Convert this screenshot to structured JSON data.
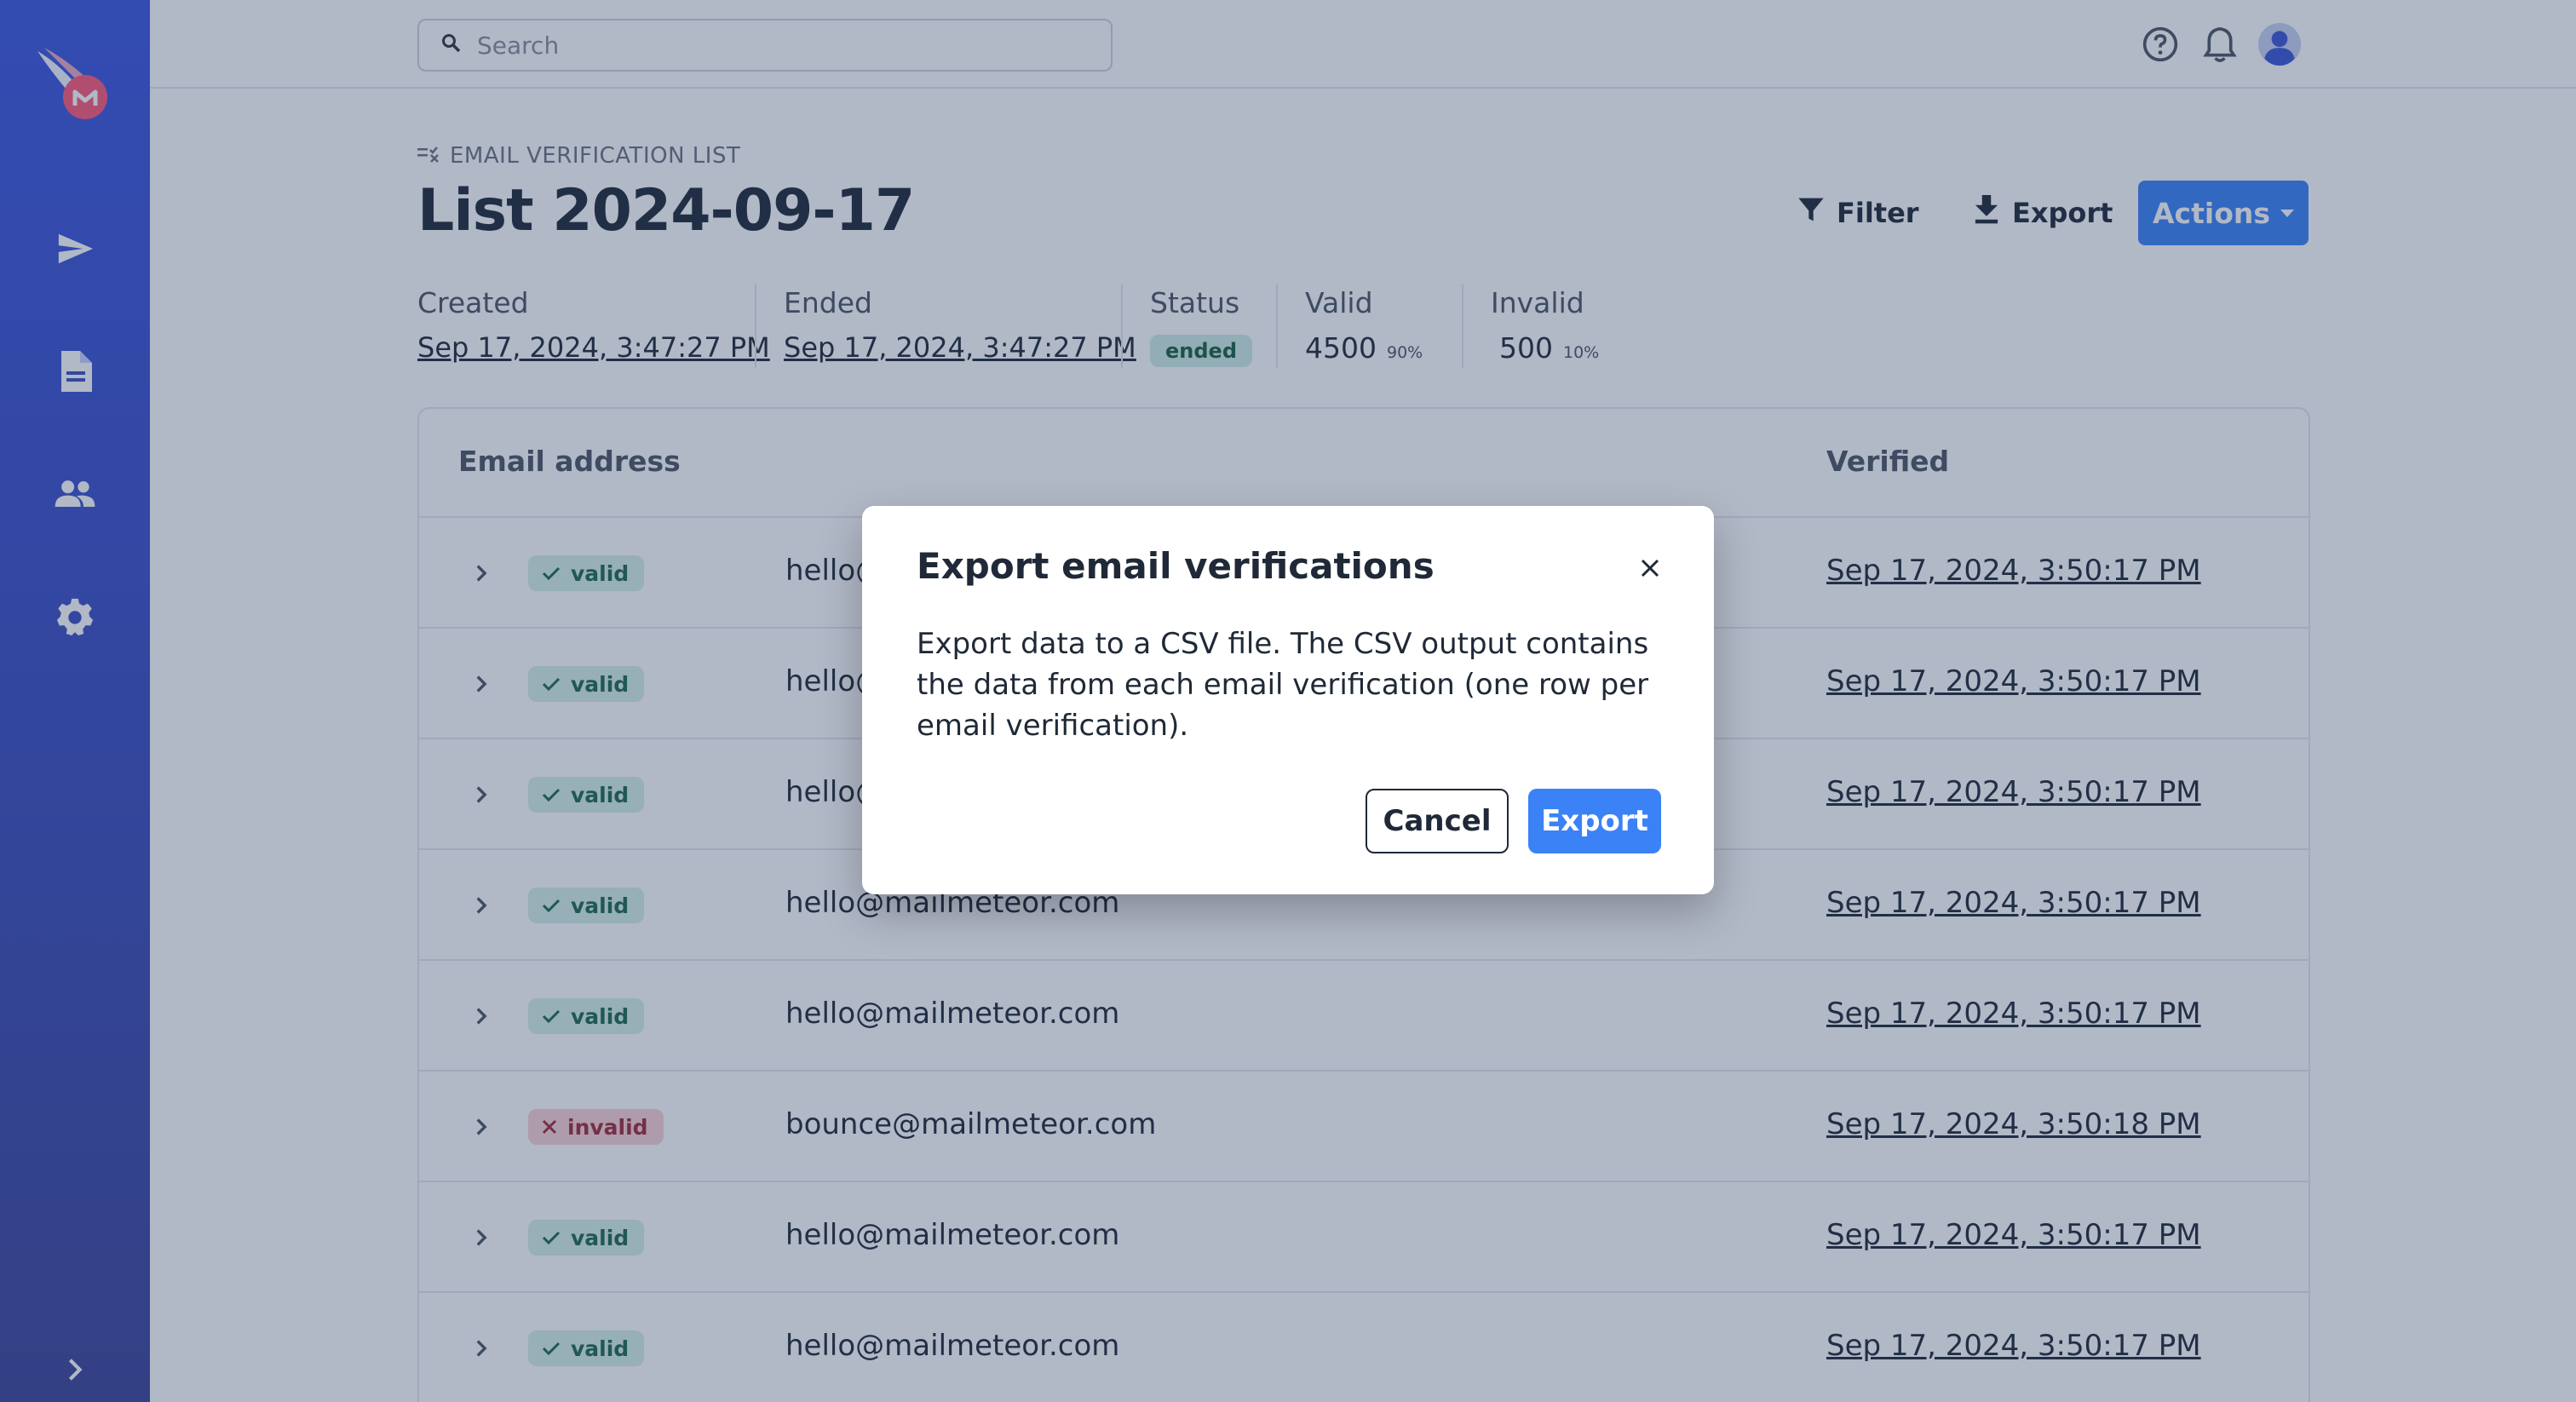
{
  "search": {
    "placeholder": "Search"
  },
  "breadcrumb": {
    "label": "EMAIL VERIFICATION LIST"
  },
  "page": {
    "title": "List 2024-09-17"
  },
  "toolbar": {
    "filter_label": "Filter",
    "export_label": "Export",
    "actions_label": "Actions"
  },
  "stats": {
    "created_label": "Created",
    "created_value": "Sep 17, 2024, 3:47:27 PM",
    "ended_label": "Ended",
    "ended_value": "Sep 17, 2024, 3:47:27 PM",
    "status_label": "Status",
    "status_value": "ended",
    "valid_label": "Valid",
    "valid_count": "4500",
    "valid_pct": "90%",
    "invalid_label": "Invalid",
    "invalid_count": "500",
    "invalid_pct": "10%"
  },
  "table": {
    "columns": [
      "Email address",
      "Verified"
    ],
    "rows": [
      {
        "status": "valid",
        "email": "hello@mailmeteor.com",
        "verified": "Sep 17, 2024, 3:50:17 PM"
      },
      {
        "status": "valid",
        "email": "hello@mailmeteor.com",
        "verified": "Sep 17, 2024, 3:50:17 PM"
      },
      {
        "status": "valid",
        "email": "hello@mailmeteor.com",
        "verified": "Sep 17, 2024, 3:50:17 PM"
      },
      {
        "status": "valid",
        "email": "hello@mailmeteor.com",
        "verified": "Sep 17, 2024, 3:50:17 PM"
      },
      {
        "status": "valid",
        "email": "hello@mailmeteor.com",
        "verified": "Sep 17, 2024, 3:50:17 PM"
      },
      {
        "status": "invalid",
        "email": "bounce@mailmeteor.com",
        "verified": "Sep 17, 2024, 3:50:18 PM"
      },
      {
        "status": "valid",
        "email": "hello@mailmeteor.com",
        "verified": "Sep 17, 2024, 3:50:17 PM"
      },
      {
        "status": "valid",
        "email": "hello@mailmeteor.com",
        "verified": "Sep 17, 2024, 3:50:17 PM"
      }
    ]
  },
  "modal": {
    "title": "Export email verifications",
    "body": "Export data to a CSV file. The CSV output contains the data from each email verification (one row per email verification).",
    "cancel_label": "Cancel",
    "export_label": "Export"
  },
  "icons": {
    "logo": "mailmeteor-logo-icon",
    "send": "send-icon",
    "document": "document-icon",
    "contacts": "people-icon",
    "settings": "gear-icon",
    "expand": "chevron-right-icon",
    "help": "help-icon",
    "notifications": "bell-icon",
    "user": "avatar-icon"
  },
  "colors": {
    "accent": "#3b82f6",
    "sidebar": "#3a4fc6",
    "valid_badge": "#d6f1e6",
    "invalid_badge": "#fad3d6",
    "status_badge": "#cfeee4"
  }
}
